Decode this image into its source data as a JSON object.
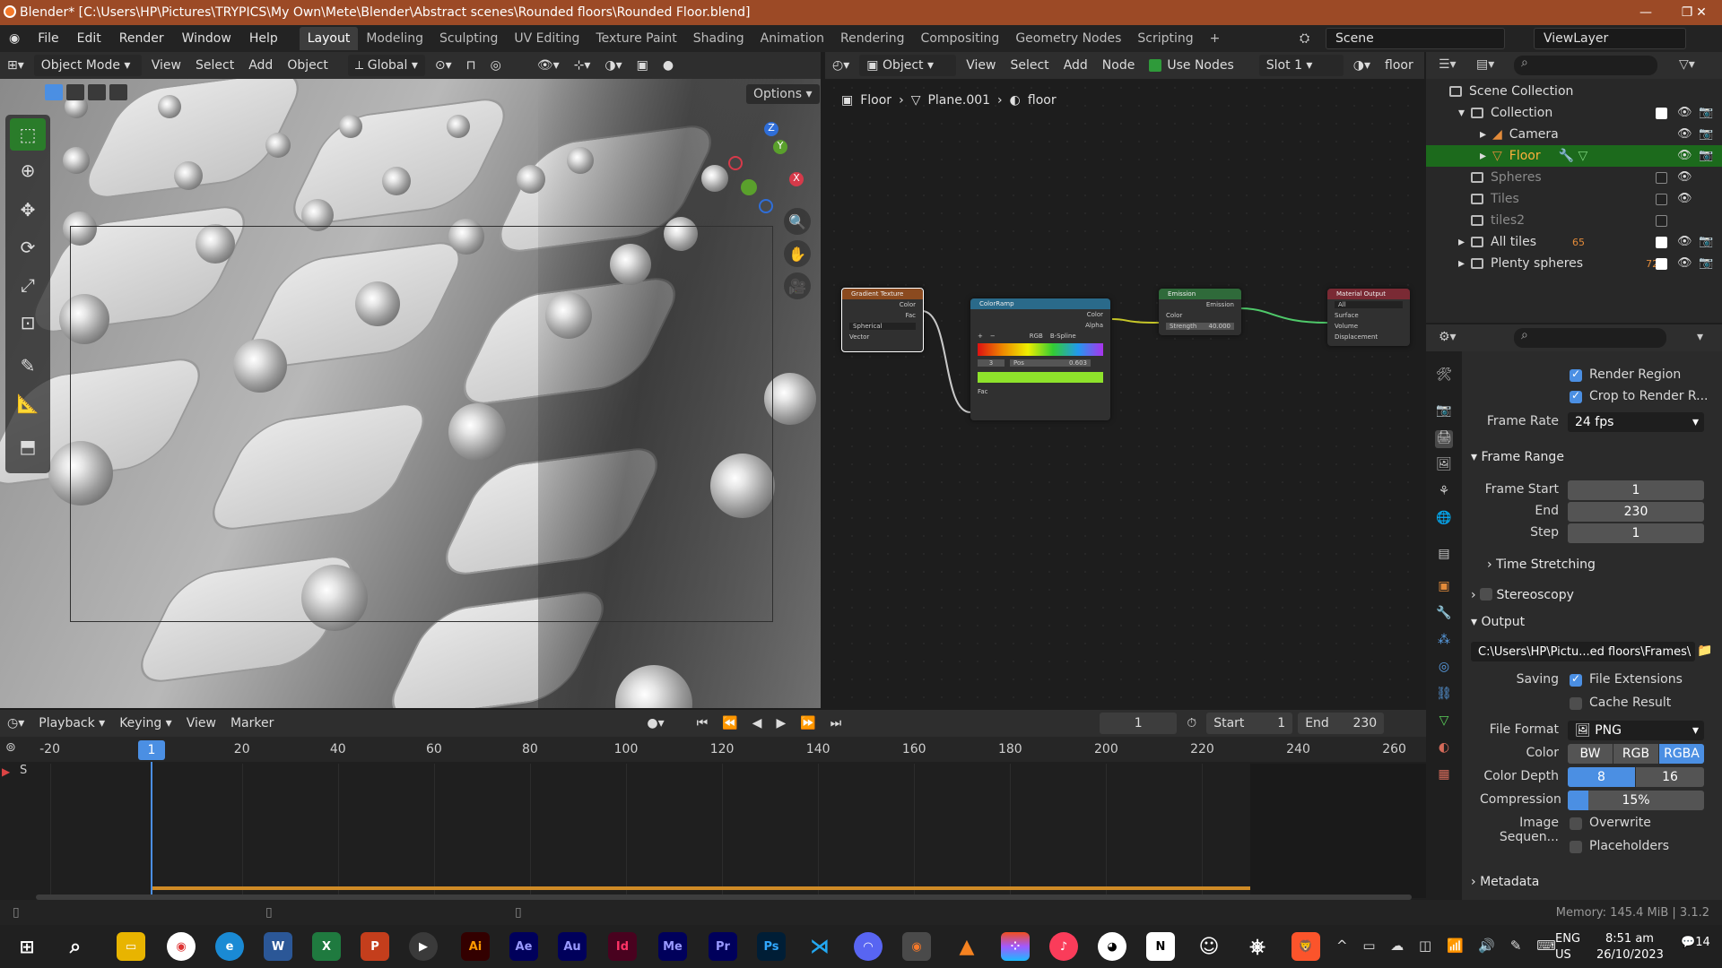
{
  "window": {
    "title": "Blender* [C:\\Users\\HP\\Pictures\\TRYPICS\\My Own\\Mete\\Blender\\Abstract scenes\\Rounded floors\\Rounded Floor.blend]",
    "minimize": "—",
    "maximize": "❐",
    "close": "✕"
  },
  "menu": {
    "items": [
      "File",
      "Edit",
      "Render",
      "Window",
      "Help"
    ],
    "workspaces": [
      "Layout",
      "Modeling",
      "Sculpting",
      "UV Editing",
      "Texture Paint",
      "Shading",
      "Animation",
      "Rendering",
      "Compositing",
      "Geometry Nodes",
      "Scripting",
      "+"
    ],
    "active_workspace": "Layout",
    "scene": "Scene",
    "view_layer": "ViewLayer"
  },
  "viewport": {
    "mode": "Object Mode",
    "menus": [
      "View",
      "Select",
      "Add",
      "Object"
    ],
    "transform": "Global",
    "options": "Options"
  },
  "node_editor": {
    "object_type": "Object",
    "menus": [
      "View",
      "Select",
      "Add",
      "Node"
    ],
    "use_nodes": "Use Nodes",
    "slot": "Slot 1",
    "material": "floor",
    "breadcrumb": [
      "Floor",
      "Plane.001",
      "floor"
    ],
    "nodes": {
      "gradient": {
        "title": "Gradient Texture",
        "out1": "Color",
        "out2": "Fac",
        "type": "Spherical",
        "in": "Vector"
      },
      "ramp": {
        "title": "ColorRamp",
        "out1": "Color",
        "out2": "Alpha",
        "mode": "RGB",
        "interp": "B-Spline",
        "idx": "3",
        "pos_label": "Pos",
        "pos": "0.603",
        "in": "Fac"
      },
      "emission": {
        "title": "Emission",
        "out": "Emission",
        "in1": "Color",
        "strength_label": "Strength",
        "strength": "40.000"
      },
      "output": {
        "title": "Material Output",
        "target": "All",
        "in1": "Surface",
        "in2": "Volume",
        "in3": "Displacement"
      }
    }
  },
  "outliner": {
    "root": "Scene Collection",
    "rows": [
      {
        "name": "Collection",
        "level": 1
      },
      {
        "name": "Camera",
        "level": 2
      },
      {
        "name": "Floor",
        "level": 2
      },
      {
        "name": "Spheres",
        "level": 1
      },
      {
        "name": "Tiles",
        "level": 1
      },
      {
        "name": "tiles2",
        "level": 1
      },
      {
        "name": "All tiles",
        "level": 1,
        "badge": "65"
      },
      {
        "name": "Plenty spheres",
        "level": 1,
        "badge": "72"
      }
    ]
  },
  "properties": {
    "render_region": "Render Region",
    "crop": "Crop to Render R...",
    "frame_rate_label": "Frame Rate",
    "frame_rate": "24 fps",
    "frame_range": "Frame Range",
    "frame_start_label": "Frame Start",
    "frame_start": "1",
    "end_label": "End",
    "end": "230",
    "step_label": "Step",
    "step": "1",
    "time_stretching": "Time Stretching",
    "stereoscopy": "Stereoscopy",
    "output": "Output",
    "output_path": "C:\\Users\\HP\\Pictu...ed floors\\Frames\\",
    "saving_label": "Saving",
    "file_extensions": "File Extensions",
    "cache_result": "Cache Result",
    "file_format_label": "File Format",
    "file_format": "PNG",
    "color_label": "Color",
    "color_opts": [
      "BW",
      "RGB",
      "RGBA"
    ],
    "color_depth_label": "Color Depth",
    "depth_opts": [
      "8",
      "16"
    ],
    "compression_label": "Compression",
    "compression": "15%",
    "compression_fraction": 0.15,
    "image_seq_label": "Image Sequen...",
    "overwrite": "Overwrite",
    "placeholders": "Placeholders",
    "metadata": "Metadata"
  },
  "timeline": {
    "menus": [
      "Playback",
      "Keying",
      "View",
      "Marker"
    ],
    "current_frame": "1",
    "start_label": "Start",
    "start": "1",
    "end_label": "End",
    "end": "230",
    "ticks": [
      "-20",
      "1",
      "20",
      "40",
      "60",
      "80",
      "100",
      "120",
      "140",
      "160",
      "180",
      "200",
      "220",
      "240",
      "260"
    ],
    "track_label": "S"
  },
  "status": {
    "memory": "Memory: 145.4 MiB | 3.1.2"
  },
  "taskbar": {
    "lang1": "ENG",
    "lang2": "US",
    "time": "8:51 am",
    "date": "26/10/2023",
    "notif": "14"
  },
  "colors": {
    "title_bg": "#9c4a26",
    "accent_blue": "#4b8fe3",
    "selected_green": "#1c6a1c",
    "playhead": "#4b8fe3",
    "frame_range": "#cf8b26"
  }
}
